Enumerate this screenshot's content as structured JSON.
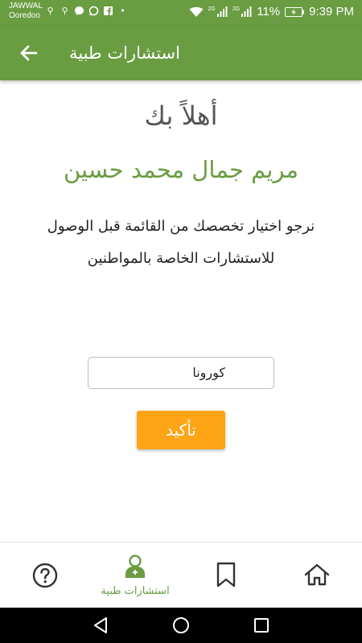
{
  "status_bar": {
    "carrier_line1": "JAWWAL",
    "carrier_line2": "Ooredoo",
    "network_type_1": "2G",
    "network_type_2": "2G",
    "battery": "11%",
    "time": "9:39 PM"
  },
  "app_bar": {
    "title": "استشارات طبية"
  },
  "content": {
    "greeting": "أهلاً بك",
    "user_name": "مريم جمال محمد حسين",
    "instructions": "نرجو اختيار تخصصك من القائمة قبل الوصول للاستشارات الخاصة بالمواطنين",
    "specialty_value": "كورونا",
    "confirm_label": "تأكيد"
  },
  "bottom_nav": {
    "active_label": "استشارات طبية",
    "items": [
      "help-icon",
      "medical-consultation-icon",
      "bookmark-icon",
      "home-icon"
    ]
  },
  "colors": {
    "primary": "#6a9c42",
    "accent": "#ffa414"
  }
}
